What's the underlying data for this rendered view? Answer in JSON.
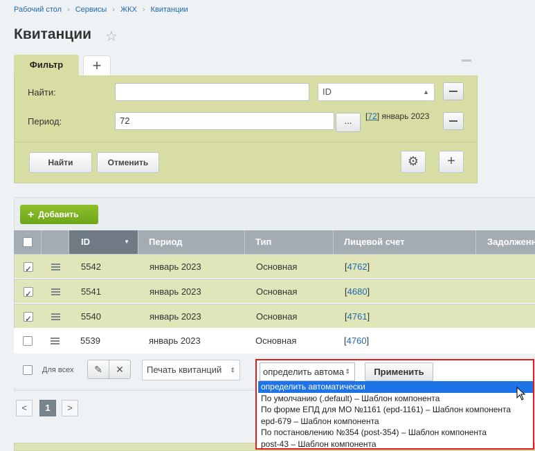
{
  "breadcrumb": [
    "Рабочий стол",
    "Сервисы",
    "ЖКХ",
    "Квитанции"
  ],
  "page": {
    "title": "Квитанции"
  },
  "filter": {
    "tab_label": "Фильтр",
    "find_label": "Найти:",
    "find_value": "",
    "find_field_select": "ID",
    "period_label": "Период:",
    "period_value": "72",
    "period_button": "...",
    "period_link_id": "72",
    "period_text": "январь 2023",
    "find_button": "Найти",
    "cancel_button": "Отменить"
  },
  "grid": {
    "add_button": "Добавить",
    "columns": [
      "ID",
      "Период",
      "Тип",
      "Лицевой счет",
      "Задолженн"
    ],
    "rows": [
      {
        "checked": true,
        "id": "5542",
        "period": "январь 2023",
        "type": "Основная",
        "account": "4762"
      },
      {
        "checked": true,
        "id": "5541",
        "period": "январь 2023",
        "type": "Основная",
        "account": "4680"
      },
      {
        "checked": true,
        "id": "5540",
        "period": "январь 2023",
        "type": "Основная",
        "account": "4761"
      },
      {
        "checked": false,
        "id": "5539",
        "period": "январь 2023",
        "type": "Основная",
        "account": "4760"
      }
    ],
    "for_all_label": "Для всех",
    "print_select": "Печать квитанций"
  },
  "action": {
    "select_value": "определить автома",
    "apply_button": "Применить",
    "options": [
      "определить автоматически",
      "По умолчанию (.default) – Шаблон компонента",
      "По форме ЕПД для МО №1161 (epd-1161) – Шаблон компонента",
      "epd-679 – Шаблон компонента",
      "По постановлению №354 (post-354) – Шаблон компонента",
      "post-43 – Шаблон компонента"
    ],
    "highlighted_index": 0
  },
  "pager": {
    "current": "1",
    "prev": "<",
    "next": ">"
  }
}
